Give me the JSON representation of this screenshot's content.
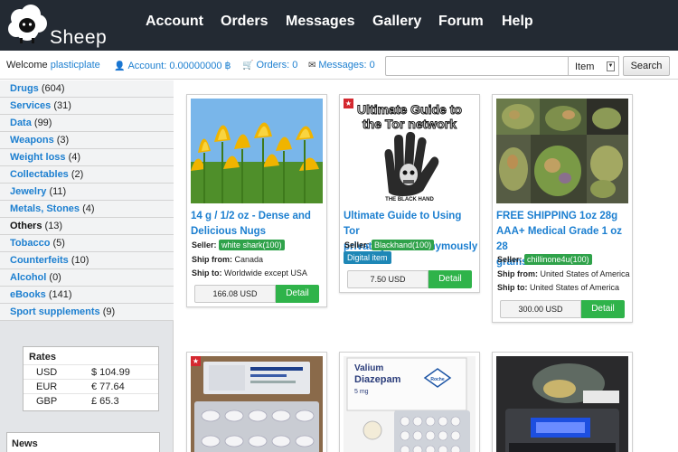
{
  "header": {
    "brand": "Sheep",
    "nav": [
      "Account",
      "Orders",
      "Messages",
      "Gallery",
      "Forum",
      "Help"
    ]
  },
  "userbar": {
    "welcome_label": "Welcome",
    "username": "plasticplate",
    "account_label": "Account:",
    "account_value": "0.00000000 ฿",
    "orders_label": "Orders:",
    "orders_value": "0",
    "messages_label": "Messages:",
    "messages_value": "0",
    "search_value": "",
    "search_type": "Item",
    "search_button": "Search"
  },
  "sidebar": {
    "categories": [
      {
        "name": "Drugs",
        "count": "(604)"
      },
      {
        "name": "Services",
        "count": "(31)"
      },
      {
        "name": "Data",
        "count": "(99)"
      },
      {
        "name": "Weapons",
        "count": "(3)"
      },
      {
        "name": "Weight loss",
        "count": "(4)"
      },
      {
        "name": "Collectables",
        "count": "(2)"
      },
      {
        "name": "Jewelry",
        "count": "(11)"
      },
      {
        "name": "Metals, Stones",
        "count": "(4)"
      },
      {
        "name": "Others",
        "count": "(13)"
      },
      {
        "name": "Tobacco",
        "count": "(5)"
      },
      {
        "name": "Counterfeits",
        "count": "(10)"
      },
      {
        "name": "Alcohol",
        "count": "(0)"
      },
      {
        "name": "eBooks",
        "count": "(141)"
      },
      {
        "name": "Sport supplements",
        "count": "(9)"
      }
    ],
    "rates": {
      "title": "Rates",
      "rows": [
        {
          "currency": "USD",
          "amount": "$ 104.99"
        },
        {
          "currency": "EUR",
          "amount": "€ 77.64"
        },
        {
          "currency": "GBP",
          "amount": "£ 65.3"
        }
      ]
    },
    "news_title": "News"
  },
  "listings": [
    {
      "title_line1": "14 g / 1/2 oz - Dense and",
      "title_line2": "Delicious Nugs",
      "seller_label": "Seller:",
      "seller": "white shark(100)",
      "ship_from_label": "Ship from:",
      "ship_from": "Canada",
      "ship_to_label": "Ship to:",
      "ship_to": "Worldwide except USA",
      "price": "166.08 USD",
      "button": "Detail"
    },
    {
      "title_line1": "Ultimate Guide to Using Tor",
      "title_line2": "privately and anonymously",
      "seller_label": "Seller:",
      "seller": "Blackhand(100)",
      "digital": "Digital item",
      "price": "7.50 USD",
      "button": "Detail",
      "cover_line1": "Ultimate Guide to",
      "cover_line2": "the Tor network",
      "cover_footer": "THE BLACK HAND"
    },
    {
      "title_line1": "FREE SHIPPING 1oz 28g",
      "title_line2": "AAA+ Medical Grade 1 oz 28",
      "title_line3": "grams",
      "seller_label": "Seller:",
      "seller": "chillinone4u(100)",
      "ship_from_label": "Ship from:",
      "ship_from": "United States of America",
      "ship_to_label": "Ship to:",
      "ship_to": "United States of America",
      "price": "300.00 USD",
      "button": "Detail"
    },
    {},
    {
      "box_brand": "Valium",
      "box_name": "Diazepam",
      "box_dose": "5 mg",
      "box_maker": "Roche"
    },
    {}
  ],
  "colors": {
    "topbar": "#232a33",
    "link": "#1c7fd0",
    "seller_badge": "#2fa24a",
    "digital_badge": "#1e87b6",
    "detail_button": "#2fb34a",
    "featured_star": "#d4282f"
  }
}
